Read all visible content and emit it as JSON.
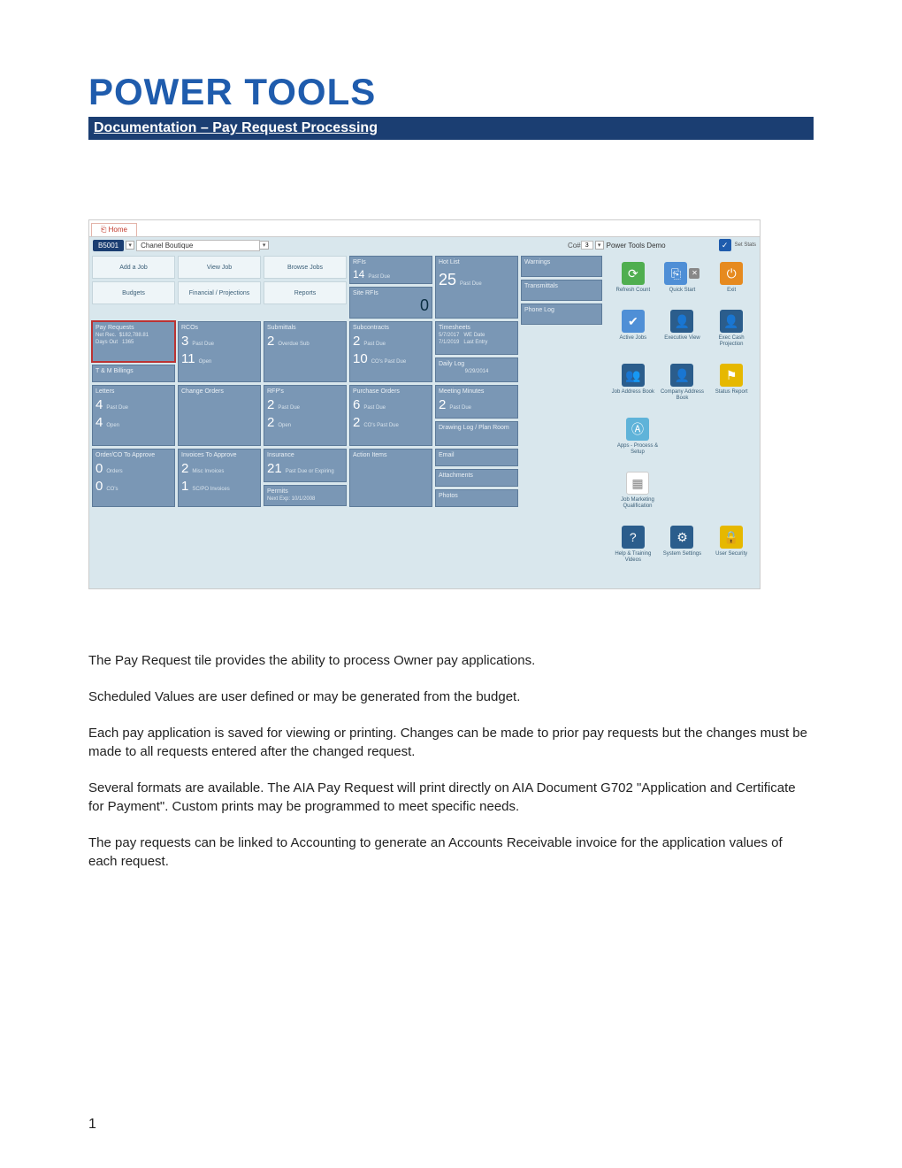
{
  "doc": {
    "title": "POWER TOOLS",
    "subtitle": "Documentation – Pay Request Processing",
    "page_number": "1"
  },
  "app": {
    "tab": "Home",
    "job_code": "B5001",
    "job_name": "Chanel Boutique",
    "co_label": "Co#",
    "co_value": "3",
    "company_name": "Power Tools Demo",
    "stats_toggle": "Set Stats"
  },
  "nav": {
    "add_job": "Add a Job",
    "view_job": "View Job",
    "browse_jobs": "Browse Jobs",
    "budgets": "Budgets",
    "fin_proj": "Financial / Projections",
    "reports": "Reports"
  },
  "tiles": {
    "rfis": {
      "title": "RFIs",
      "val": "14",
      "lbl": "Past Due"
    },
    "site_rfis": {
      "title": "Site RFIs",
      "val": "0"
    },
    "hotlist": {
      "title": "Hot List",
      "val": "25",
      "lbl": "Past Due"
    },
    "warnings": {
      "title": "Warnings"
    },
    "transmittals": {
      "title": "Transmittals"
    },
    "phonelog": {
      "title": "Phone Log"
    },
    "payreq": {
      "title": "Pay Requests",
      "line1_l": "Net Rec.",
      "line1_v": "$182,788.81",
      "line2_l": "Days Out",
      "line2_v": "1365"
    },
    "tm": {
      "title": "T & M Billings"
    },
    "rcos": {
      "title": "RCOs",
      "v1": "3",
      "l1": "Past Due",
      "v2": "11",
      "l2": "Open"
    },
    "submittals": {
      "title": "Submittals",
      "v1": "2",
      "l1": "Overdue Sub"
    },
    "subcontracts": {
      "title": "Subcontracts",
      "v1": "2",
      "l1": "Past Due",
      "v2": "10",
      "l2": "CO's Past Due"
    },
    "timesheets": {
      "title": "Timesheets",
      "l1a": "5/7/2017",
      "l1b": "WE Date",
      "l2a": "7/1/2019",
      "l2b": "Last Entry"
    },
    "dailylog": {
      "title": "Daily Log",
      "date": "9/29/2014"
    },
    "letters": {
      "title": "Letters",
      "v1": "4",
      "l1": "Past Due",
      "v2": "4",
      "l2": "Open"
    },
    "changeorders": {
      "title": "Change Orders"
    },
    "rfps": {
      "title": "RFP's",
      "v1": "2",
      "l1": "Past Due",
      "v2": "2",
      "l2": "Open"
    },
    "pos": {
      "title": "Purchase Orders",
      "v1": "6",
      "l1": "Past Due",
      "v2": "2",
      "l2": "CO's Past Due"
    },
    "minutes": {
      "title": "Meeting Minutes",
      "v1": "2",
      "l1": "Past Due"
    },
    "drawing": {
      "title": "Drawing Log / Plan Room"
    },
    "orderco": {
      "title": "Order/CO To Approve",
      "v1": "0",
      "l1": "Orders",
      "v2": "0",
      "l2": "CO's"
    },
    "invoices": {
      "title": "Invoices To Approve",
      "v1": "2",
      "l1": "Misc Invoices",
      "v2": "1",
      "l2": "SC/PO Invoices"
    },
    "insurance": {
      "title": "Insurance",
      "v1": "21",
      "l1": "Past Due or Expiring"
    },
    "permits": {
      "title": "Permits",
      "l1": "Next Exp:  10/1/2008"
    },
    "actionitems": {
      "title": "Action Items"
    },
    "email": {
      "title": "Email"
    },
    "attachments": {
      "title": "Attachments"
    },
    "photos": {
      "title": "Photos"
    }
  },
  "side": {
    "refresh": "Refresh Count",
    "quickstart": "Quick Start",
    "exit": "Exit",
    "activejobs": "Active Jobs",
    "execview": "Executive View",
    "execcash": "Exec Cash Projection",
    "jobaddr": "Job Address Book",
    "company": "Company Address Book",
    "status": "Status Report",
    "apps": "Apps - Process & Setup",
    "marketing": "Job Marketing Qualification",
    "help": "Help & Training Videos",
    "settings": "System Settings",
    "security": "User Security"
  },
  "body": {
    "p1": "The Pay Request tile provides the ability to process Owner pay applications.",
    "p2": "Scheduled Values are user defined or may be generated from the budget.",
    "p3": "Each pay application is saved for viewing or printing.  Changes can be made to prior pay requests but the changes must be made to all requests entered after the changed request.",
    "p4": "Several formats are available.  The AIA Pay Request will print directly on AIA Document G702 \"Application and Certificate for Payment\".   Custom prints may be programmed to meet specific needs.",
    "p5": "The pay requests can be linked to Accounting to generate an Accounts Receivable invoice for the application values of each request."
  }
}
